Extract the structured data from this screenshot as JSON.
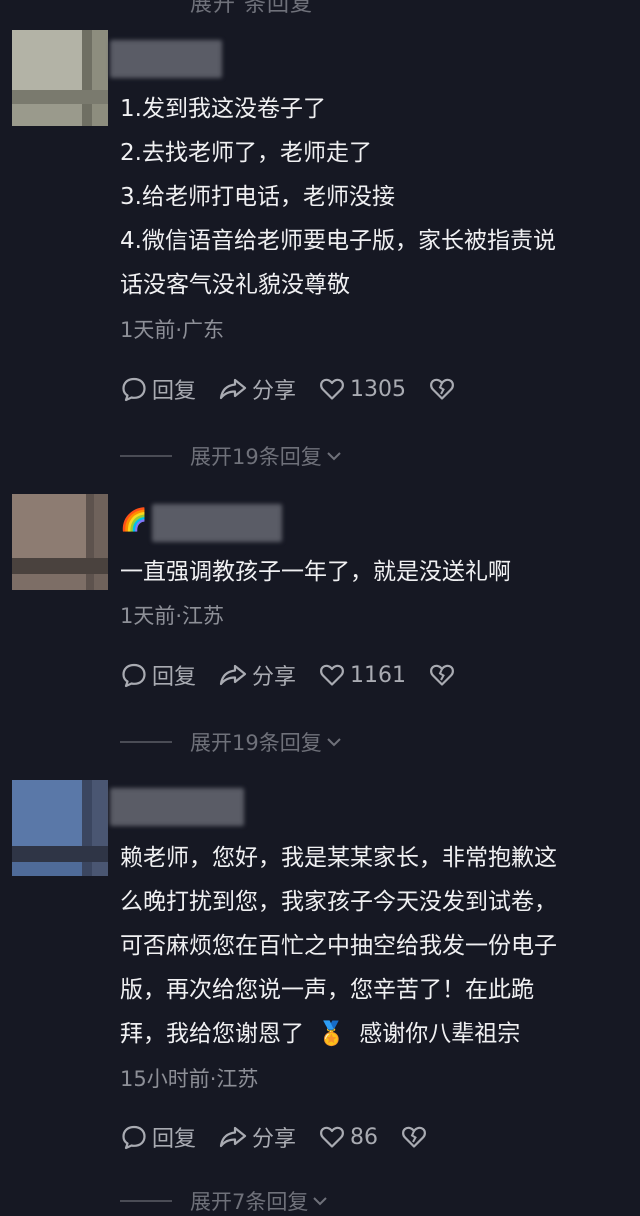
{
  "top_expand_partial": "展开 条回复",
  "comments": [
    {
      "lines": [
        "1.发到我这没卷子了",
        "2.去找老师了，老师走了",
        "3.给老师打电话，老师没接",
        "4.微信语音给老师要电子版，家长被指责说",
        "话没客气没礼貌没尊敬"
      ],
      "meta": "1天前·广东",
      "reply_label": "回复",
      "share_label": "分享",
      "likes": "1305",
      "expand": "展开19条回复"
    },
    {
      "name_emoji": "🌈",
      "lines": [
        "一直强调教孩子一年了，就是没送礼啊"
      ],
      "meta": "1天前·江苏",
      "reply_label": "回复",
      "share_label": "分享",
      "likes": "1161",
      "expand": "展开19条回复"
    },
    {
      "lines": [
        "赖老师，您好，我是某某家长，非常抱歉这",
        "么晚打扰到您，我家孩子今天没发到试卷，",
        "可否麻烦您在百忙之中抽空给我发一份电子",
        "版，再次给您说一声，您辛苦了！在此跪",
        "拜，我给您谢恩了",
        "感谢你八辈祖宗"
      ],
      "inline_emoji": "🏅",
      "meta": "15小时前·江苏",
      "reply_label": "回复",
      "share_label": "分享",
      "likes": "86",
      "expand": "展开7条回复"
    }
  ]
}
